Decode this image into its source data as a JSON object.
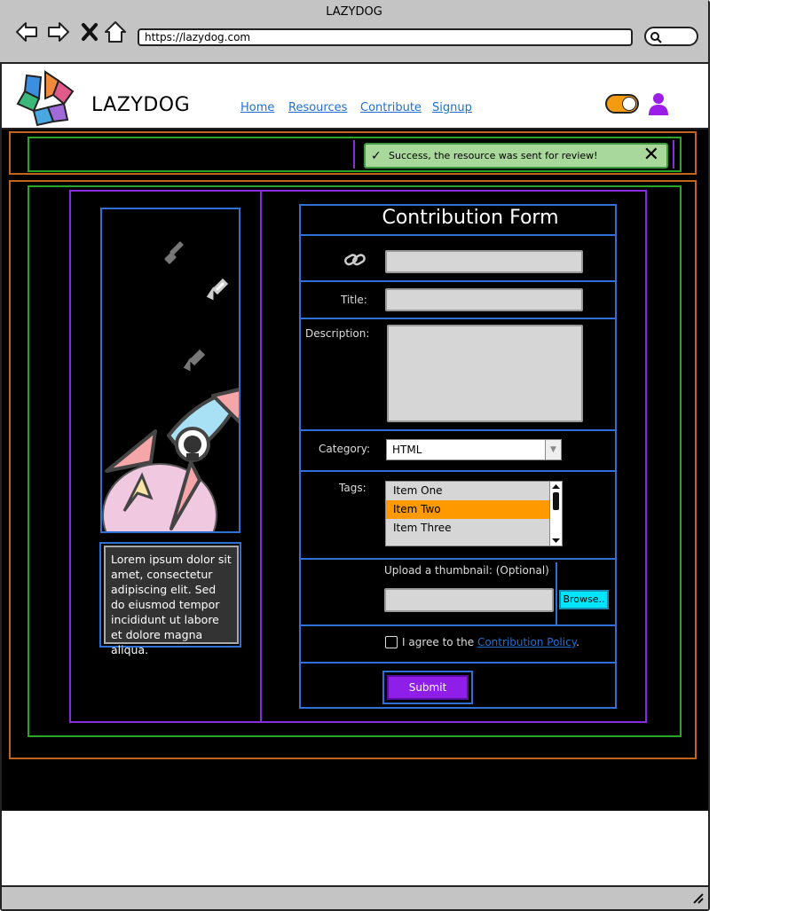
{
  "browser": {
    "title": "LAZYDOG",
    "url": "https://lazydog.com",
    "nav_icons": [
      "back-arrow-icon",
      "forward-arrow-icon",
      "close-icon",
      "home-icon"
    ],
    "search_icon": "search-icon"
  },
  "header": {
    "logo_text": "LAZYDOG",
    "nav": [
      "Home",
      "Resources",
      "Contribute",
      "Signup"
    ],
    "toggle_state": "on",
    "user_icon": "user-icon"
  },
  "alert": {
    "text": "Success, the resource was sent for review!",
    "icon": "check-icon",
    "close_icon": "close-icon"
  },
  "sidebar": {
    "lorem": "Lorem ipsum dolor sit amet, consectetur adipiscing elit. Sed do eiusmod tempor incididunt ut labore et dolore magna aliqua."
  },
  "form": {
    "title": "Contribution Form",
    "link_icon": "link-icon",
    "title_label": "Title:",
    "description_label": "Description:",
    "category_label": "Category:",
    "category_value": "HTML",
    "tags_label": "Tags:",
    "tags": [
      {
        "label": "Item One",
        "selected": false
      },
      {
        "label": "Item Two",
        "selected": true
      },
      {
        "label": "Item Three",
        "selected": false
      }
    ],
    "upload_label": "Upload a thumbnail: (Optional)",
    "browse_label": "Browse..",
    "agree_prefix": "I agree to the ",
    "agree_link": "Contribution Policy",
    "agree_suffix": ".",
    "submit_label": "Submit"
  },
  "colors": {
    "accent_orange": "#ff9900",
    "submit_purple": "#8e1ee8",
    "link_blue": "#1f6fd0",
    "success_green": "#a8d89a",
    "browse_cyan": "#00e5ff"
  }
}
